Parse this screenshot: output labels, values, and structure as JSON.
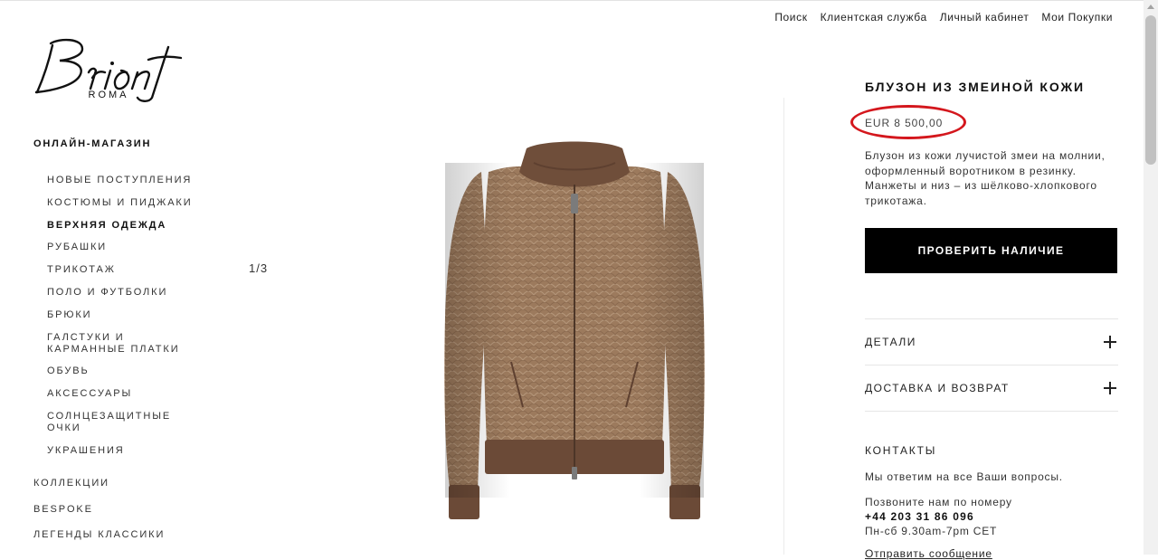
{
  "topnav": {
    "search": "Поиск",
    "customer_service": "Клиентская служба",
    "account": "Личный кабинет",
    "orders": "Мои Покупки"
  },
  "logo": {
    "brand": "Brioni",
    "sub": "ROMA"
  },
  "sidebar": {
    "heading": "ОНЛАЙН-МАГАЗИН",
    "items": [
      {
        "label": "НОВЫЕ ПОСТУПЛЕНИЯ"
      },
      {
        "label": "КОСТЮМЫ И ПИДЖАКИ"
      },
      {
        "label": "ВЕРХНЯЯ ОДЕЖДА"
      },
      {
        "label": "РУБАШКИ"
      },
      {
        "label": "ТРИКОТАЖ"
      },
      {
        "label": "ПОЛО И ФУТБОЛКИ"
      },
      {
        "label": "БРЮКИ"
      },
      {
        "label": "ГАЛСТУКИ И КАРМАННЫЕ ПЛАТКИ"
      },
      {
        "label": "ОБУВЬ"
      },
      {
        "label": "АКСЕССУАРЫ"
      },
      {
        "label": "СОЛНЦЕЗАЩИТНЫЕ ОЧКИ"
      },
      {
        "label": "УКРАШЕНИЯ"
      }
    ],
    "active_item": "ВЕРХНЯЯ ОДЕЖДА",
    "collections": "КОЛЛЕКЦИИ",
    "bespoke": "BESPOKE",
    "legends": "ЛЕГЕНДЫ КЛАССИКИ"
  },
  "gallery": {
    "counter": "1/3"
  },
  "product": {
    "title": "БЛУЗОН ИЗ ЗМЕИНОЙ КОЖИ",
    "price": "EUR 8 500,00",
    "description": "Блузон из кожи лучистой змеи на молнии, оформленный воротником в резинку. Манжеты и низ – из шёлково-хлопкового трикотажа.",
    "check_button": "ПРОВЕРИТЬ НАЛИЧИЕ",
    "details": "ДЕТАЛИ",
    "shipping": "ДОСТАВКА И ВОЗВРАТ"
  },
  "contacts": {
    "title": "КОНТАКТЫ",
    "answer": "Мы ответим на все Ваши вопросы.",
    "call": "Позвоните нам по номеру",
    "phone": "+44 203 31 86 096",
    "hours": "Пн-сб 9.30am-7pm CET",
    "send": "Отправить сообщение"
  },
  "colors": {
    "accent_black": "#000000",
    "highlight_circle": "#d4171d",
    "jacket_brown": "#8b6a4f"
  },
  "icons": [
    "plus-icon",
    "brioni-logo"
  ]
}
